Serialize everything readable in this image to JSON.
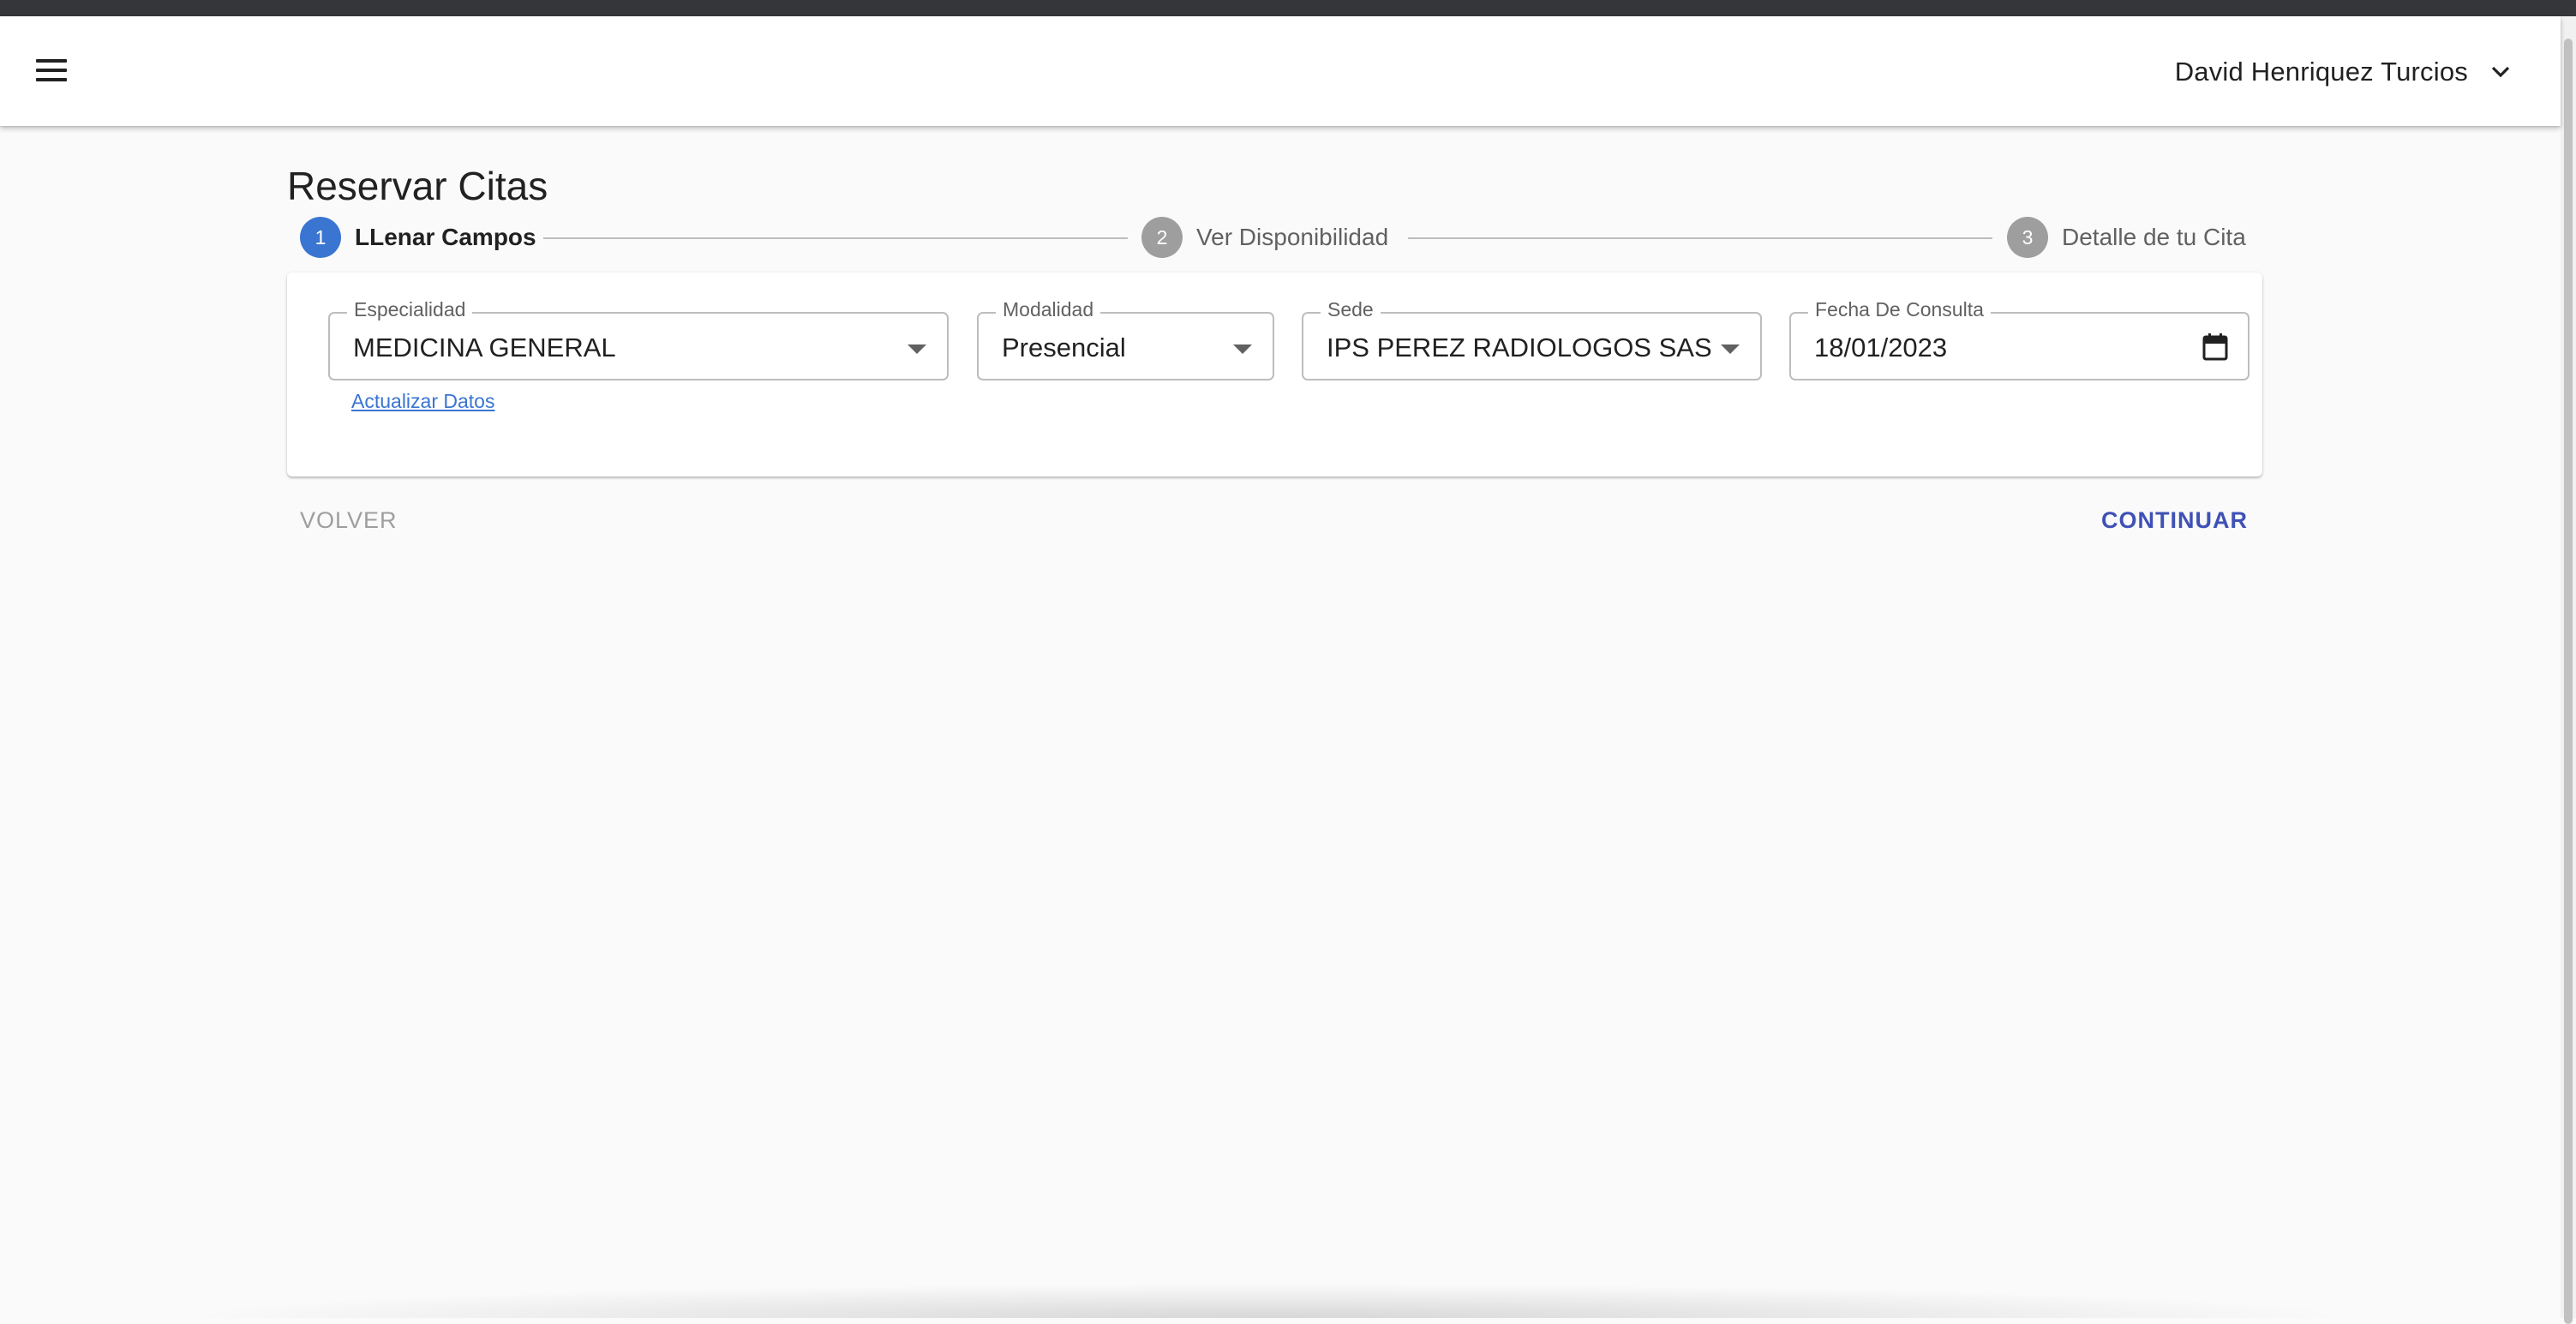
{
  "header": {
    "user_name": "David Henriquez Turcios"
  },
  "page": {
    "title": "Reservar Citas"
  },
  "stepper": {
    "steps": [
      {
        "number": "1",
        "label": "LLenar Campos"
      },
      {
        "number": "2",
        "label": "Ver Disponibilidad"
      },
      {
        "number": "3",
        "label": "Detalle de tu Cita"
      }
    ]
  },
  "form": {
    "especialidad": {
      "label": "Especialidad",
      "value": "MEDICINA GENERAL"
    },
    "modalidad": {
      "label": "Modalidad",
      "value": "Presencial"
    },
    "sede": {
      "label": "Sede",
      "value": "IPS PEREZ RADIOLOGOS SAS"
    },
    "fecha": {
      "label": "Fecha De Consulta",
      "value": "18/01/2023"
    },
    "update_link": "Actualizar Datos"
  },
  "actions": {
    "back_label": "VOLVER",
    "continue_label": "CONTINUAR"
  },
  "icons": {
    "menu": "menu-icon",
    "user_dropdown": "chevron-down-icon",
    "select": "caret-down-icon",
    "date": "calendar-icon"
  },
  "colors": {
    "accent": "#3a75d1",
    "primary_button": "#3f51b5",
    "inactive_step": "#9e9e9e",
    "background": "#fafafa"
  }
}
